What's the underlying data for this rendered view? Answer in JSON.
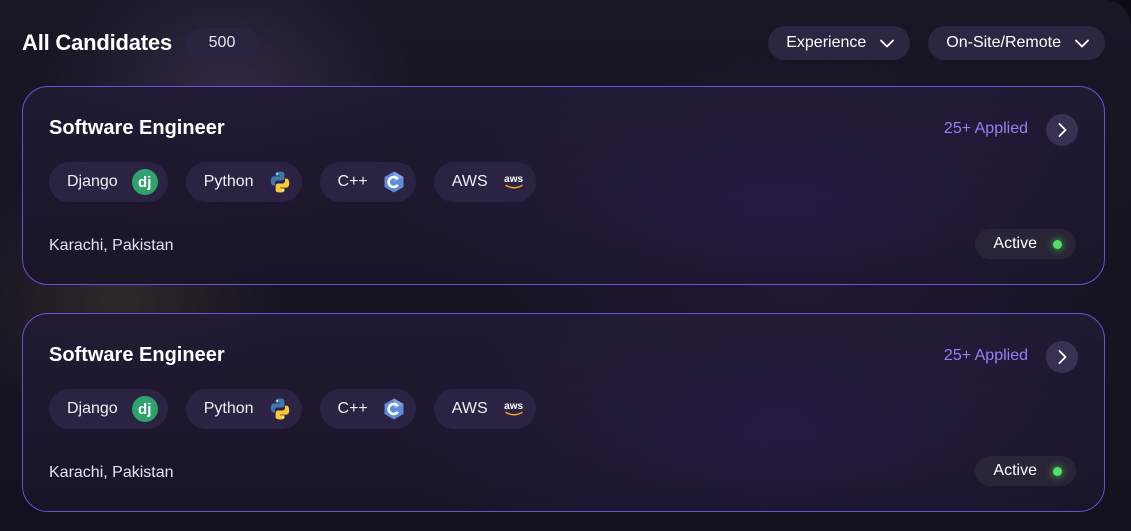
{
  "header": {
    "title": "All Candidates",
    "count": "500",
    "filters": [
      {
        "label": "Experience",
        "icon": "chevron-down-icon"
      },
      {
        "label": "On-Site/Remote",
        "icon": "chevron-down-icon"
      }
    ]
  },
  "jobs": [
    {
      "title": "Software Engineer",
      "applied": "25+ Applied",
      "skills": [
        {
          "label": "Django",
          "icon": "django-logo-icon",
          "logo_text": "dj"
        },
        {
          "label": "Python",
          "icon": "python-logo-icon"
        },
        {
          "label": "C++",
          "icon": "cpp-logo-icon"
        },
        {
          "label": "AWS",
          "icon": "aws-logo-icon",
          "logo_text": "aws"
        }
      ],
      "location": "Karachi, Pakistan",
      "status": "Active"
    },
    {
      "title": "Software Engineer",
      "applied": "25+ Applied",
      "skills": [
        {
          "label": "Django",
          "icon": "django-logo-icon",
          "logo_text": "dj"
        },
        {
          "label": "Python",
          "icon": "python-logo-icon"
        },
        {
          "label": "C++",
          "icon": "cpp-logo-icon"
        },
        {
          "label": "AWS",
          "icon": "aws-logo-icon",
          "logo_text": "aws"
        }
      ],
      "location": "Karachi, Pakistan",
      "status": "Active"
    }
  ],
  "colors": {
    "accent": "#6a4fd8",
    "applied_text": "#9b7cf7",
    "active_dot": "#53e066",
    "django": "#2ea36e",
    "cpp": "#5c8dd6",
    "python_blue": "#3f77ad",
    "python_yellow": "#f5c93a"
  }
}
